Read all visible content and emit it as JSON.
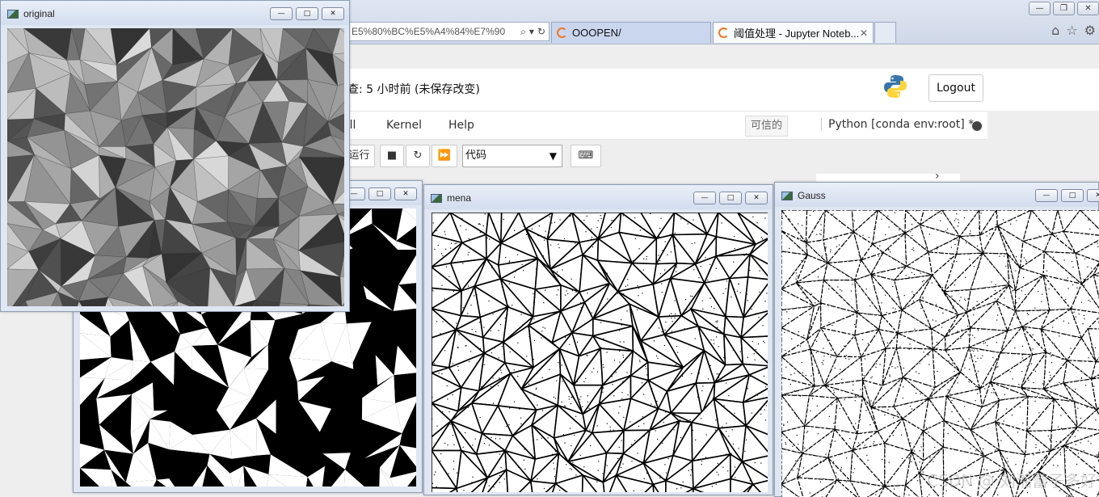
{
  "browser": {
    "url_fragment": "E5%80%BC%E5%A4%84%E7%90",
    "tabs": [
      {
        "label": "OOOPEN/"
      },
      {
        "label": "阈值处理 - Jupyter Noteb..."
      }
    ],
    "tab_close": "✕"
  },
  "notebook": {
    "save_status": "查: 5 小时前  (未保存改变)",
    "logout_label": "Logout",
    "menu": [
      "ell",
      "Kernel",
      "Help"
    ],
    "trusted_label": "可信的",
    "kernel_label": "Python [conda env:root] *",
    "run_label": "运行",
    "cell_type": "代码"
  },
  "windows": [
    {
      "title": "original"
    },
    {
      "title": ""
    },
    {
      "title": "mena"
    },
    {
      "title": "Gauss"
    }
  ],
  "watermark": "CSDN @ 刘湘蕾子多好",
  "colors": {
    "titlebar": "#d3ddee",
    "accent": "#f37726"
  }
}
